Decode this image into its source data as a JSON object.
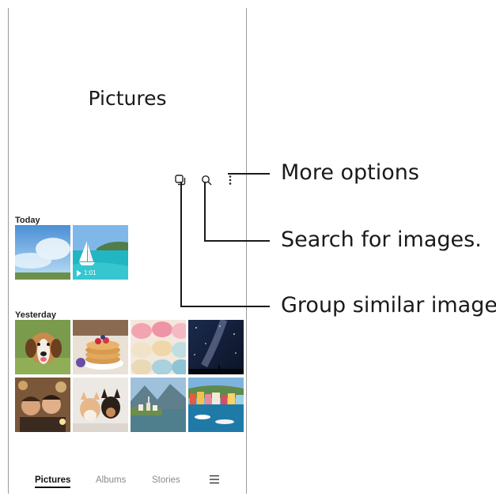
{
  "header": {
    "title": "Pictures"
  },
  "toolbar": {
    "icons": [
      "group-similar-icon",
      "search-icon",
      "more-options-icon"
    ]
  },
  "sections": {
    "today": {
      "label": "Today",
      "video_duration": "1:01"
    },
    "yesterday": {
      "label": "Yesterday"
    }
  },
  "bottom_nav": {
    "tabs": [
      "Pictures",
      "Albums",
      "Stories"
    ],
    "active": "Pictures",
    "menu_icon": "menu-icon"
  },
  "callouts": {
    "more_options": "More options",
    "search": "Search for images.",
    "group": "Group similar images."
  }
}
